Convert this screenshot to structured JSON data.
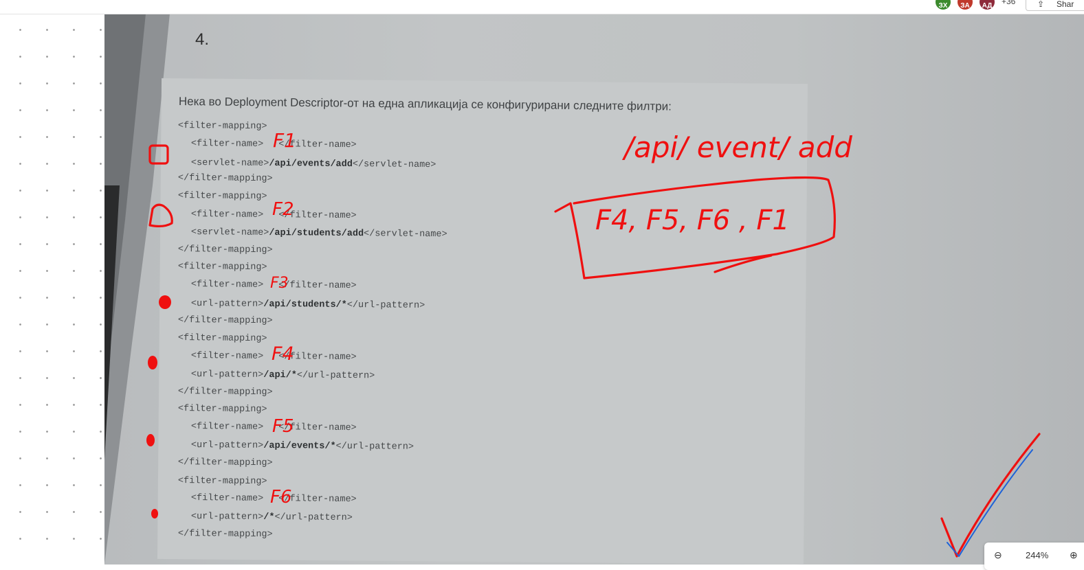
{
  "topbar": {
    "avatars": [
      {
        "initials": "ЗХ",
        "color": "#3b8a2c"
      },
      {
        "initials": "ЗА",
        "color": "#c0392b"
      },
      {
        "initials": "АД",
        "color": "#8e2a3a"
      }
    ],
    "more_count": "+36",
    "share_label": "Shar"
  },
  "document": {
    "page_number": "4.",
    "question": "Нека во Deployment Descriptor-от на една апликација се конфигурирани следните филтри:",
    "code": [
      {
        "text": "<filter-mapping>",
        "indent": 0
      },
      {
        "pre": "<filter-name>",
        "strong": "",
        "post": "</filter-name>",
        "indent": 1
      },
      {
        "pre": "<servlet-name>",
        "strong": "/api/events/add",
        "post": "</servlet-name>",
        "indent": 1
      },
      {
        "text": "</filter-mapping>",
        "indent": 0
      },
      {
        "text": "<filter-mapping>",
        "indent": 0
      },
      {
        "pre": "<filter-name>",
        "strong": "",
        "post": "</filter-name>",
        "indent": 1
      },
      {
        "pre": "<servlet-name>",
        "strong": "/api/students/add",
        "post": "</servlet-name>",
        "indent": 1
      },
      {
        "text": "</filter-mapping>",
        "indent": 0
      },
      {
        "text": "<filter-mapping>",
        "indent": 0
      },
      {
        "pre": "<filter-name>",
        "strong": "",
        "post": "</filter-name>",
        "indent": 1
      },
      {
        "pre": "<url-pattern>",
        "strong": "/api/students/*",
        "post": "</url-pattern>",
        "indent": 1
      },
      {
        "text": "</filter-mapping>",
        "indent": 0
      },
      {
        "text": "<filter-mapping>",
        "indent": 0
      },
      {
        "pre": "<filter-name>",
        "strong": "",
        "post": "</filter-name>",
        "indent": 1
      },
      {
        "pre": "<url-pattern>",
        "strong": "/api/*",
        "post": "</url-pattern>",
        "indent": 1
      },
      {
        "text": "</filter-mapping>",
        "indent": 0
      },
      {
        "text": "<filter-mapping>",
        "indent": 0
      },
      {
        "pre": "<filter-name>",
        "strong": "",
        "post": "</filter-name>",
        "indent": 1
      },
      {
        "pre": "<url-pattern>",
        "strong": "/api/events/*",
        "post": "</url-pattern>",
        "indent": 1
      },
      {
        "text": "</filter-mapping>",
        "indent": 0
      },
      {
        "text": "<filter-mapping>",
        "indent": 0
      },
      {
        "pre": "<filter-name>",
        "strong": "",
        "post": "</filter-name>",
        "indent": 1
      },
      {
        "pre": "<url-pattern>",
        "strong": "/*",
        "post": "</url-pattern>",
        "indent": 1
      },
      {
        "text": "</filter-mapping>",
        "indent": 0
      }
    ]
  },
  "annotations": {
    "filter_labels": [
      "F1",
      "F2",
      "F3",
      "F4",
      "F5",
      "F6"
    ],
    "url_note": "/api/ event/ add",
    "answer": "F4, F5, F6 , F1",
    "ink_color": "#ef1010",
    "check_color": "#1d62d8"
  },
  "zoom": {
    "level": "244%",
    "out_icon": "zoom-out-icon",
    "in_icon": "zoom-in-icon"
  }
}
